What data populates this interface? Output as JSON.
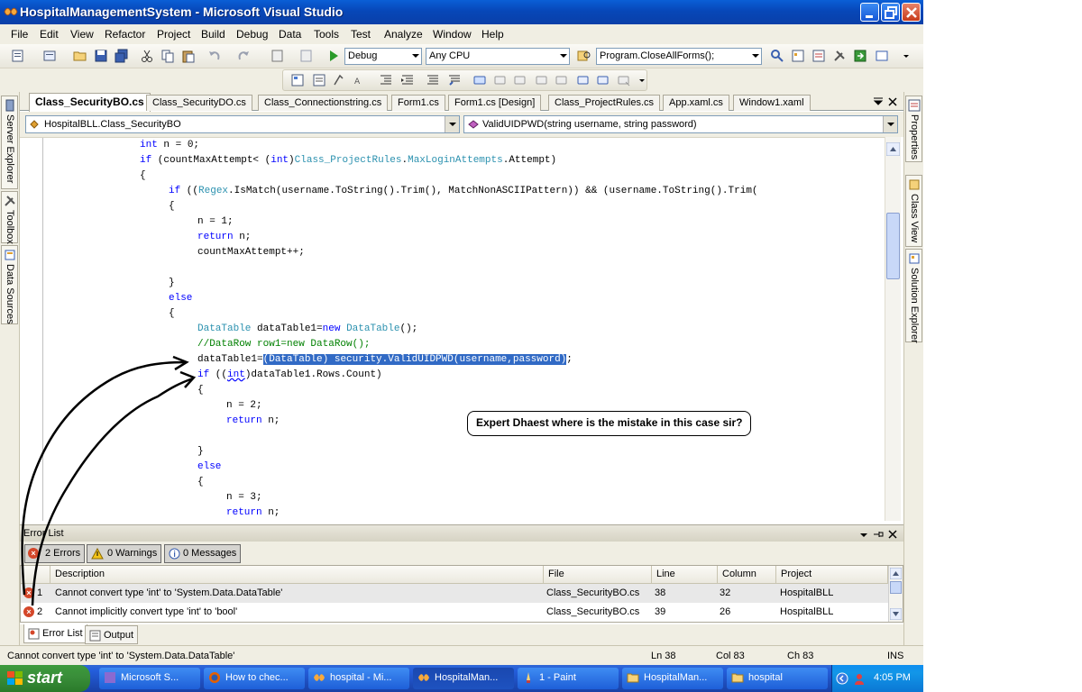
{
  "window": {
    "title": "HospitalManagementSystem - Microsoft Visual Studio"
  },
  "menu": [
    "File",
    "Edit",
    "View",
    "Refactor",
    "Project",
    "Build",
    "Debug",
    "Data",
    "Tools",
    "Test",
    "Analyze",
    "Window",
    "Help"
  ],
  "toolbar": {
    "config": "Debug",
    "platform": "Any CPU",
    "find": "Program.CloseAllForms();"
  },
  "left_panels": [
    "Server Explorer",
    "Toolbox",
    "Data Sources"
  ],
  "right_panels": [
    "Properties",
    "Class View",
    "Solution Explorer"
  ],
  "doc_tabs": [
    "Class_SecurityBO.cs",
    "Class_SecurityDO.cs",
    "Class_Connectionstring.cs",
    "Form1.cs",
    "Form1.cs [Design]",
    "Class_ProjectRules.cs",
    "App.xaml.cs",
    "Window1.xaml"
  ],
  "nav": {
    "type": "HospitalBLL.Class_SecurityBO",
    "member": "ValidUIDPWD(string username, string password)"
  },
  "code": {
    "l1": "int n = 0;",
    "l2_if": "if",
    "l2_a": " (countMaxAttempt< (",
    "l2_int": "int",
    "l2_b": ")",
    "l2_cls": "Class_ProjectRules",
    "l2_c": ".",
    "l2_max": "MaxLoginAttempts",
    "l2_d": ".Attempt)",
    "l3": "{",
    "l4_if": "if",
    "l4_a": " ((",
    "l4_regex": "Regex",
    "l4_b": ".IsMatch(username.ToString().Trim(), MatchNonASCIIPattern)) && (username.ToString().Trim(",
    "l5": "{",
    "l6": "n = 1;",
    "l7_ret": "return",
    "l7_b": " n;",
    "l8": "countMaxAttempt++;",
    "l9": "}",
    "l10": "else",
    "l11": "{",
    "l12_dt": "DataTable",
    "l12_a": " dataTable1=",
    "l12_new": "new",
    "l12_sp": " ",
    "l12_dt2": "DataTable",
    "l12_b": "();",
    "l13": "//DataRow row1=new DataRow();",
    "l14_a": "dataTable1=",
    "l14_sel": "(DataTable) security.ValidUIDPWD(username,password)",
    "l14_b": ";",
    "l15_if": "if",
    "l15_a": " ((",
    "l15_int": "int",
    "l15_b": ")dataTable1.Rows.Count)",
    "l16": "{",
    "l17": "n = 2;",
    "l18_ret": "return",
    "l18_b": " n;",
    "l19": "}",
    "l20": "else",
    "l21": "{",
    "l22": "n = 3;",
    "l23_ret": "return",
    "l23_b": " n;"
  },
  "callout": "Expert Dhaest where is the mistake in this case sir?",
  "error_list": {
    "title": "Error List",
    "errors_btn": "2 Errors",
    "warnings_btn": "0 Warnings",
    "messages_btn": "0 Messages",
    "columns": [
      "Description",
      "File",
      "Line",
      "Column",
      "Project"
    ],
    "rows": [
      {
        "num": "1",
        "description": "Cannot convert type 'int' to 'System.Data.DataTable'",
        "file": "Class_SecurityBO.cs",
        "line": "38",
        "column": "32",
        "project": "HospitalBLL"
      },
      {
        "num": "2",
        "description": "Cannot implicitly convert type 'int' to 'bool'",
        "file": "Class_SecurityBO.cs",
        "line": "39",
        "column": "26",
        "project": "HospitalBLL"
      }
    ]
  },
  "bottom_tabs": [
    "Error List",
    "Output"
  ],
  "status": {
    "message": "Cannot convert type 'int' to 'System.Data.DataTable'",
    "ln": "Ln 38",
    "col": "Col 83",
    "ch": "Ch 83",
    "mode": "INS"
  },
  "taskbar": {
    "start": "start",
    "items": [
      "Microsoft S...",
      "How to chec...",
      "hospital - Mi...",
      "HospitalMan...",
      "1 - Paint",
      "HospitalMan...",
      "hospital"
    ],
    "clock": "4:05 PM"
  },
  "colors": {
    "keyword": "#0000ff",
    "type": "#2b91af",
    "comment": "#008000",
    "selection": "#316ac5",
    "error_icon": "#d4472a"
  }
}
